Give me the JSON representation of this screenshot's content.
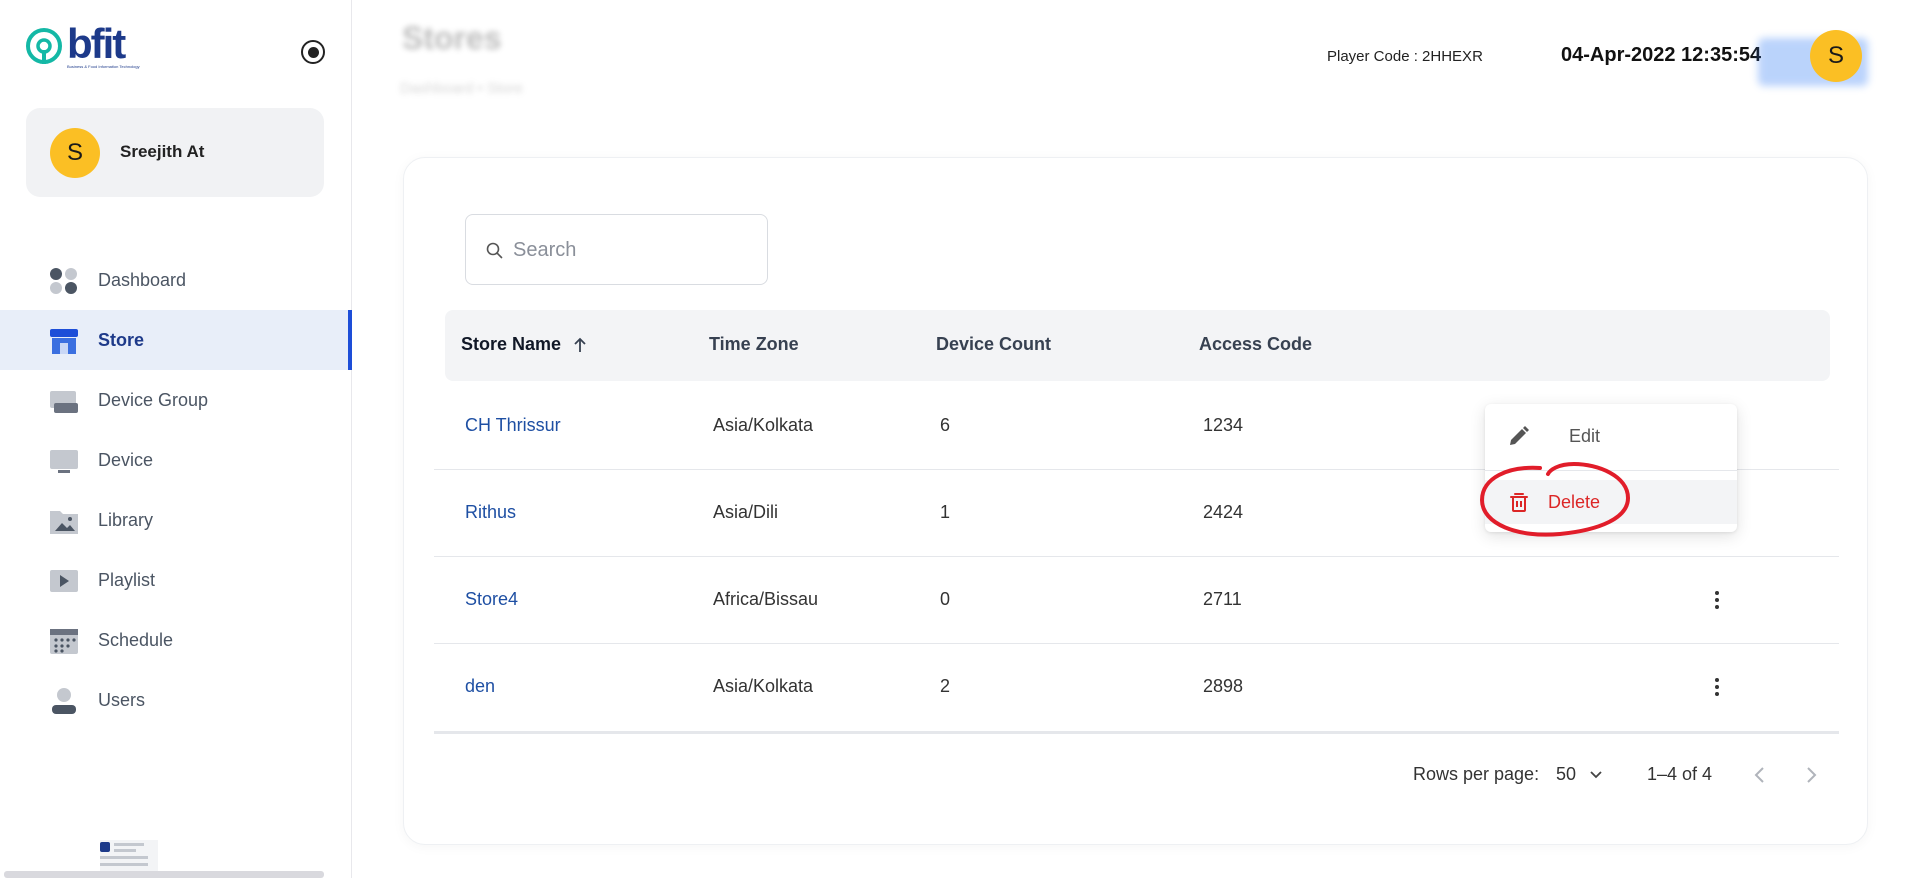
{
  "app": {
    "logo_text": "bfit",
    "logo_tagline": "Business & Food Information Technology"
  },
  "sidebar": {
    "user": {
      "initial": "S",
      "name": "Sreejith At"
    },
    "items": [
      {
        "label": "Dashboard",
        "icon": "dashboard-icon",
        "active": false
      },
      {
        "label": "Store",
        "icon": "store-icon",
        "active": true
      },
      {
        "label": "Device Group",
        "icon": "device-group-icon",
        "active": false
      },
      {
        "label": "Device",
        "icon": "device-icon",
        "active": false
      },
      {
        "label": "Library",
        "icon": "library-icon",
        "active": false
      },
      {
        "label": "Playlist",
        "icon": "playlist-icon",
        "active": false
      },
      {
        "label": "Schedule",
        "icon": "schedule-icon",
        "active": false
      },
      {
        "label": "Users",
        "icon": "users-icon",
        "active": false
      }
    ]
  },
  "header": {
    "title": "Stores",
    "breadcrumb": "Dashboard  •  Store",
    "player_code": "Player Code : 2HHEXR",
    "datetime": "04-Apr-2022 12:35:54",
    "avatar_initial": "S"
  },
  "search": {
    "placeholder": "Search",
    "value": ""
  },
  "table": {
    "columns": [
      "Store Name",
      "Time Zone",
      "Device Count",
      "Access Code"
    ],
    "sort": {
      "column": "Store Name",
      "direction": "asc"
    },
    "rows": [
      {
        "store_name": "CH Thrissur",
        "time_zone": "Asia/Kolkata",
        "device_count": "6",
        "access_code": "1234"
      },
      {
        "store_name": "Rithus",
        "time_zone": "Asia/Dili",
        "device_count": "1",
        "access_code": "2424"
      },
      {
        "store_name": "Store4",
        "time_zone": "Africa/Bissau",
        "device_count": "0",
        "access_code": "2711"
      },
      {
        "store_name": "den",
        "time_zone": "Asia/Kolkata",
        "device_count": "2",
        "access_code": "2898"
      }
    ]
  },
  "pagination": {
    "rows_per_page_label": "Rows per page:",
    "rows_per_page": "50",
    "range": "1–4 of 4"
  },
  "context_menu": {
    "edit_label": "Edit",
    "delete_label": "Delete"
  },
  "colors": {
    "accent": "#1d4ed8",
    "link": "#1e4fa3",
    "danger": "#dc2626",
    "avatar": "#fbbf24",
    "annotation": "#e11d2a"
  }
}
